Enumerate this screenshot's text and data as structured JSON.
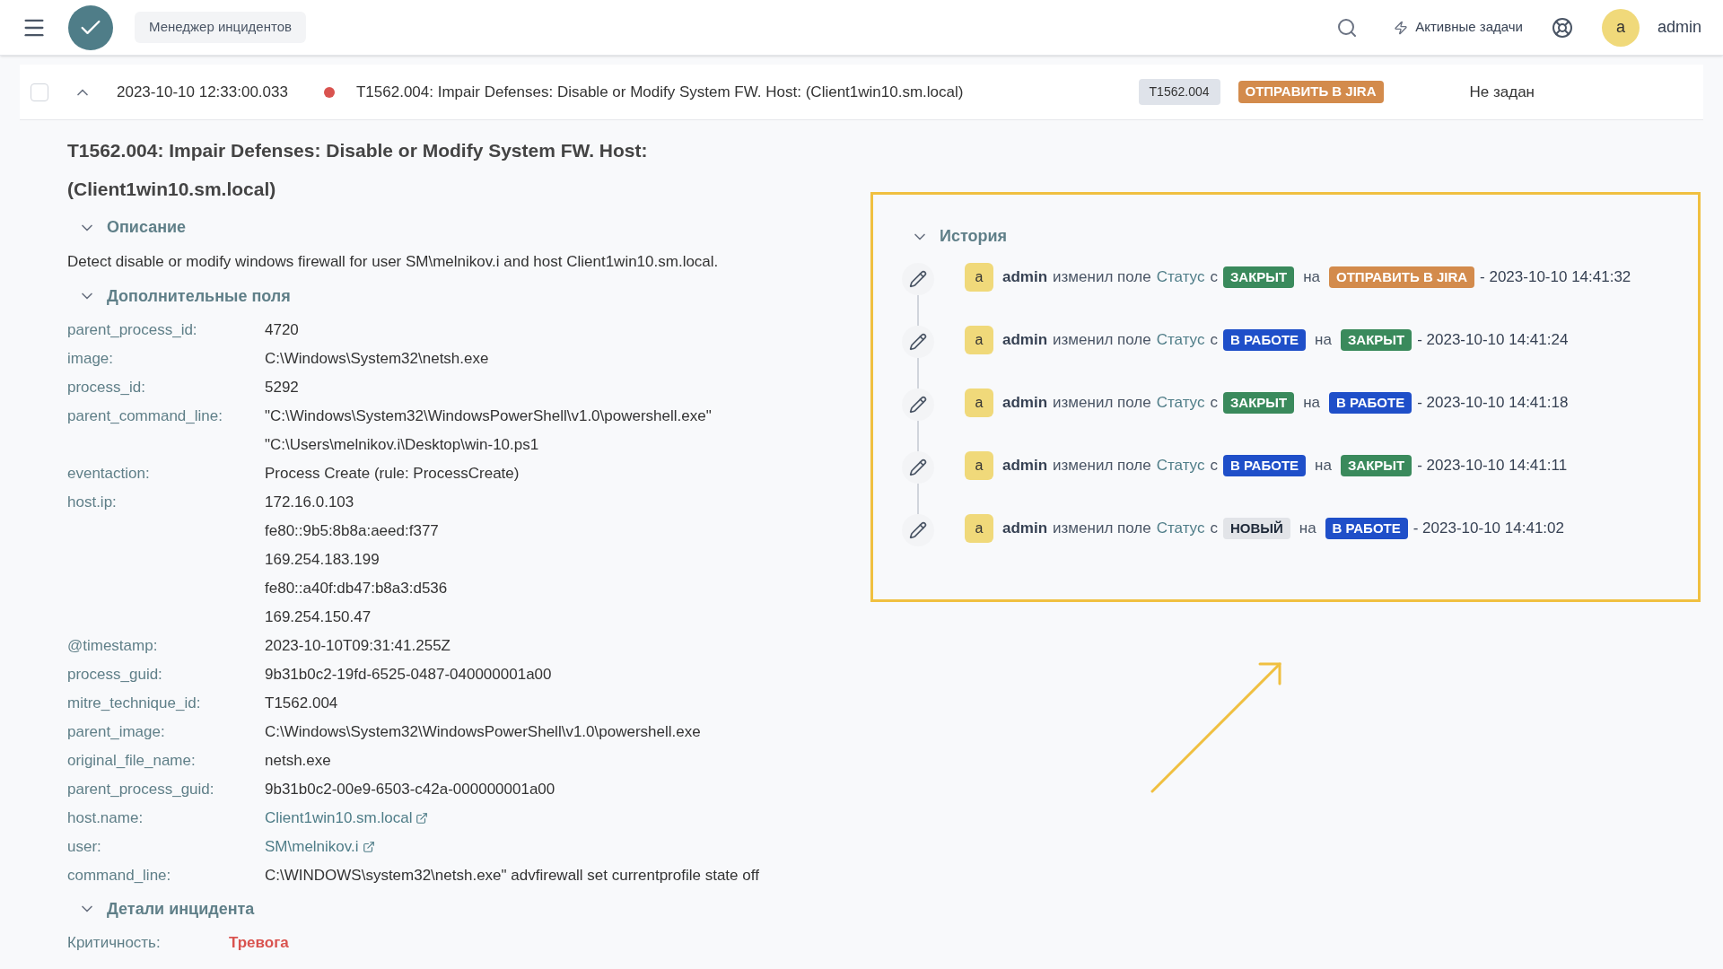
{
  "header": {
    "app_name": "Менеджер инцидентов",
    "active_tasks": "Активные задачи",
    "avatar_letter": "a",
    "user": "admin"
  },
  "incident_row": {
    "checked": false,
    "expanded": true,
    "time": "2023-10-10 12:33:00.033",
    "title": "T1562.004: Impair Defenses: Disable or Modify System FW. Host: (Client1win10.sm.local)",
    "tag": "T1562.004",
    "status": {
      "label": "ОТПРАВИТЬ В JIRA",
      "color": "#d38b4c"
    },
    "assignee": "Не задан"
  },
  "detail": {
    "title": "T1562.004: Impair Defenses: Disable or Modify System FW. Host: (Client1win10.sm.local)",
    "description": {
      "heading": "Описание",
      "expanded": true,
      "text": "Detect disable or modify windows firewall for user SM\\melnikov.i and host Client1win10.sm.local."
    },
    "extra_fields": {
      "heading": "Дополнительные поля",
      "expanded": true,
      "fields": [
        {
          "label": "parent_process_id:",
          "kind": "text",
          "values": [
            "4720"
          ]
        },
        {
          "label": "image:",
          "kind": "text",
          "values": [
            "C:\\Windows\\System32\\netsh.exe"
          ]
        },
        {
          "label": "process_id:",
          "kind": "text",
          "values": [
            "5292"
          ]
        },
        {
          "label": "parent_command_line:",
          "kind": "text",
          "values": [
            "\"C:\\Windows\\System32\\WindowsPowerShell\\v1.0\\powershell.exe\"",
            "\"C:\\Users\\melnikov.i\\Desktop\\win-10.ps1"
          ]
        },
        {
          "label": "eventaction:",
          "kind": "text",
          "values": [
            "Process Create (rule: ProcessCreate)"
          ]
        },
        {
          "label": "host.ip:",
          "kind": "text",
          "values": [
            "172.16.0.103",
            "fe80::9b5:8b8a:aeed:f377",
            "169.254.183.199",
            "fe80::a40f:db47:b8a3:d536",
            "169.254.150.47"
          ]
        },
        {
          "label": "@timestamp:",
          "kind": "text",
          "values": [
            "2023-10-10T09:31:41.255Z"
          ]
        },
        {
          "label": "process_guid:",
          "kind": "text",
          "values": [
            "9b31b0c2-19fd-6525-0487-040000001a00"
          ]
        },
        {
          "label": "mitre_technique_id:",
          "kind": "text",
          "values": [
            "T1562.004"
          ]
        },
        {
          "label": "parent_image:",
          "kind": "text",
          "values": [
            "C:\\Windows\\System32\\WindowsPowerShell\\v1.0\\powershell.exe"
          ]
        },
        {
          "label": "original_file_name:",
          "kind": "text",
          "values": [
            "netsh.exe"
          ]
        },
        {
          "label": "parent_process_guid:",
          "kind": "text",
          "values": [
            "9b31b0c2-00e9-6503-c42a-000000001a00"
          ]
        },
        {
          "label": "host.name:",
          "kind": "link",
          "values": [
            "Client1win10.sm.local"
          ]
        },
        {
          "label": "user:",
          "kind": "link",
          "values": [
            "SM\\melnikov.i"
          ]
        },
        {
          "label": "command_line:",
          "kind": "text",
          "values": [
            "C:\\WINDOWS\\system32\\netsh.exe\" advfirewall set currentprofile state off"
          ]
        }
      ]
    },
    "incident_details": {
      "heading": "Детали инцидента",
      "expanded": true,
      "fields": [
        {
          "label": "Критичность:",
          "value": "Тревога",
          "color": "#d9534f"
        }
      ]
    }
  },
  "history": {
    "heading": "История",
    "expanded": true,
    "entries": [
      {
        "avatar_letter": "a",
        "user": "admin",
        "action": "изменил поле",
        "field": "Статус",
        "from_word": "с",
        "from": {
          "label": "ЗАКРЫТ",
          "color": "#3a8a5c"
        },
        "to_word": "на",
        "to": {
          "label": "ОТПРАВИТЬ В JIRA",
          "color": "#d38b4c"
        },
        "time": "- 2023-10-10 14:41:32"
      },
      {
        "avatar_letter": "a",
        "user": "admin",
        "action": "изменил поле",
        "field": "Статус",
        "from_word": "с",
        "from": {
          "label": "В РАБОТЕ",
          "color": "#1f4fc9"
        },
        "to_word": "на",
        "to": {
          "label": "ЗАКРЫТ",
          "color": "#3a8a5c"
        },
        "time": "- 2023-10-10 14:41:24"
      },
      {
        "avatar_letter": "a",
        "user": "admin",
        "action": "изменил поле",
        "field": "Статус",
        "from_word": "с",
        "from": {
          "label": "ЗАКРЫТ",
          "color": "#3a8a5c"
        },
        "to_word": "на",
        "to": {
          "label": "В РАБОТЕ",
          "color": "#1f4fc9"
        },
        "time": "- 2023-10-10 14:41:18"
      },
      {
        "avatar_letter": "a",
        "user": "admin",
        "action": "изменил поле",
        "field": "Статус",
        "from_word": "с",
        "from": {
          "label": "В РАБОТЕ",
          "color": "#1f4fc9"
        },
        "to_word": "на",
        "to": {
          "label": "ЗАКРЫТ",
          "color": "#3a8a5c"
        },
        "time": "- 2023-10-10 14:41:11"
      },
      {
        "avatar_letter": "a",
        "user": "admin",
        "action": "изменил поле",
        "field": "Статус",
        "from_word": "с",
        "from": {
          "label": "НОВЫЙ",
          "color": "#e2e4e8"
        },
        "to_word": "на",
        "to": {
          "label": "В РАБОТЕ",
          "color": "#1f4fc9"
        },
        "time": "- 2023-10-10 14:41:02"
      }
    ]
  }
}
